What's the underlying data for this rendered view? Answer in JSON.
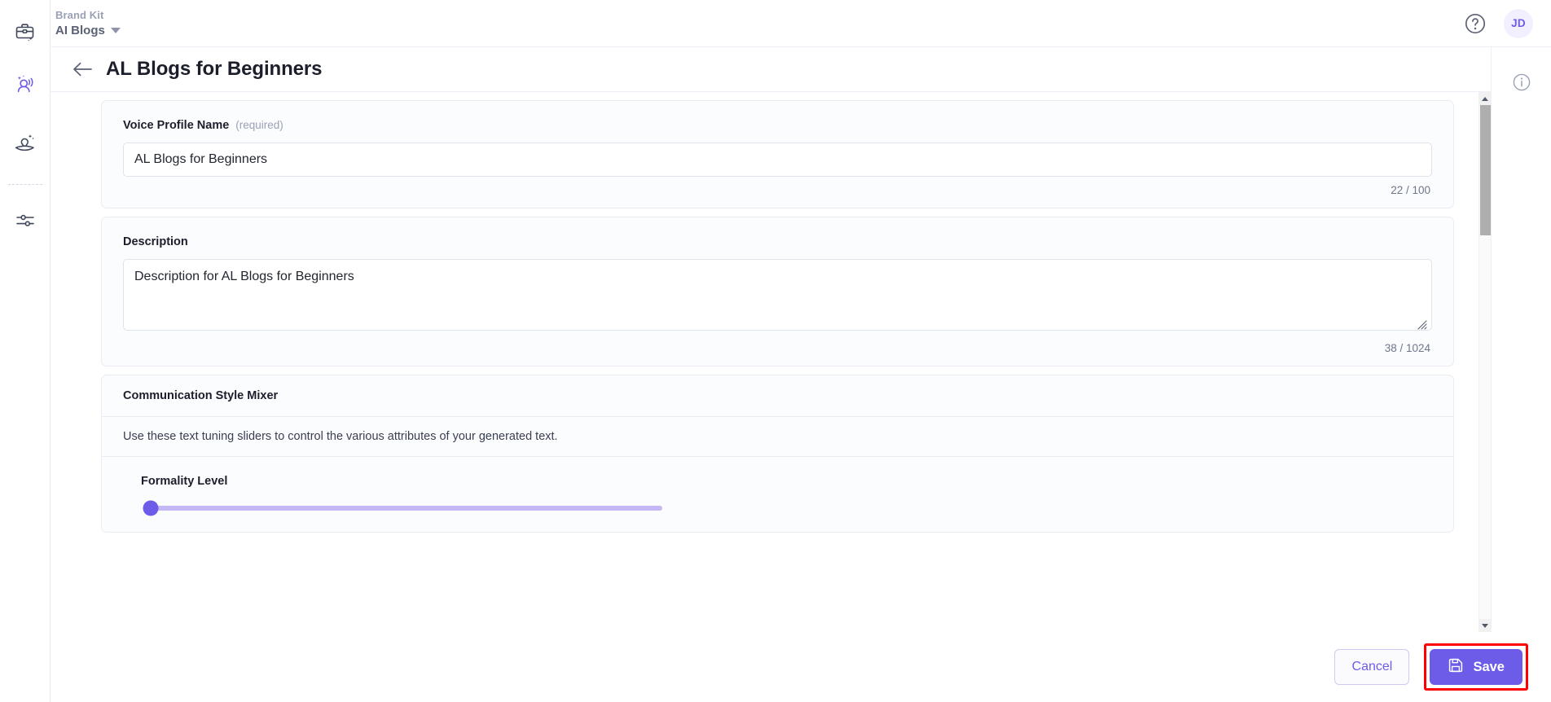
{
  "topbar": {
    "brand_kit_label": "Brand Kit",
    "brand_name": "AI Blogs",
    "caret_icon": "chevron-down-icon",
    "help_icon": "help-circle-icon",
    "avatar_initials": "JD"
  },
  "rail": {
    "items": [
      {
        "icon": "briefcase-sparkle-icon",
        "name": "brand-kit",
        "active": false
      },
      {
        "icon": "voice-profile-icon",
        "name": "voice-profiles",
        "active": true
      },
      {
        "icon": "knowledge-idea-icon",
        "name": "knowledge",
        "active": false
      },
      {
        "icon": "sliders-icon",
        "name": "settings",
        "active": false
      }
    ]
  },
  "page": {
    "back_icon": "arrow-left-icon",
    "title": "AL Blogs for Beginners"
  },
  "form": {
    "name_field": {
      "label": "Voice Profile Name",
      "required_hint": "(required)",
      "value": "AL Blogs for Beginners",
      "placeholder": "Voice Profile Name",
      "counter": "22 / 100"
    },
    "description_field": {
      "label": "Description",
      "value": "Description for AL Blogs for Beginners",
      "placeholder": "Description",
      "counter": "38 / 1024",
      "resize_icon": "resize-grip-icon"
    },
    "mixer": {
      "title": "Communication Style Mixer",
      "description": "Use these text tuning sliders to control the various attributes of your generated text.",
      "sliders": [
        {
          "label": "Formality Level",
          "value": 0,
          "min": 0,
          "max": 100
        }
      ]
    }
  },
  "info_panel": {
    "info_icon": "info-circle-icon"
  },
  "scrollbar": {
    "up_icon": "caret-up-icon",
    "down_icon": "caret-down-icon"
  },
  "footer": {
    "cancel_label": "Cancel",
    "save_label": "Save",
    "save_icon": "save-floppy-icon"
  },
  "colors": {
    "accent": "#6c5ce7",
    "slider_track": "#c3b7f6",
    "highlight": "#ff0000",
    "muted_text": "#9aa1b4"
  }
}
